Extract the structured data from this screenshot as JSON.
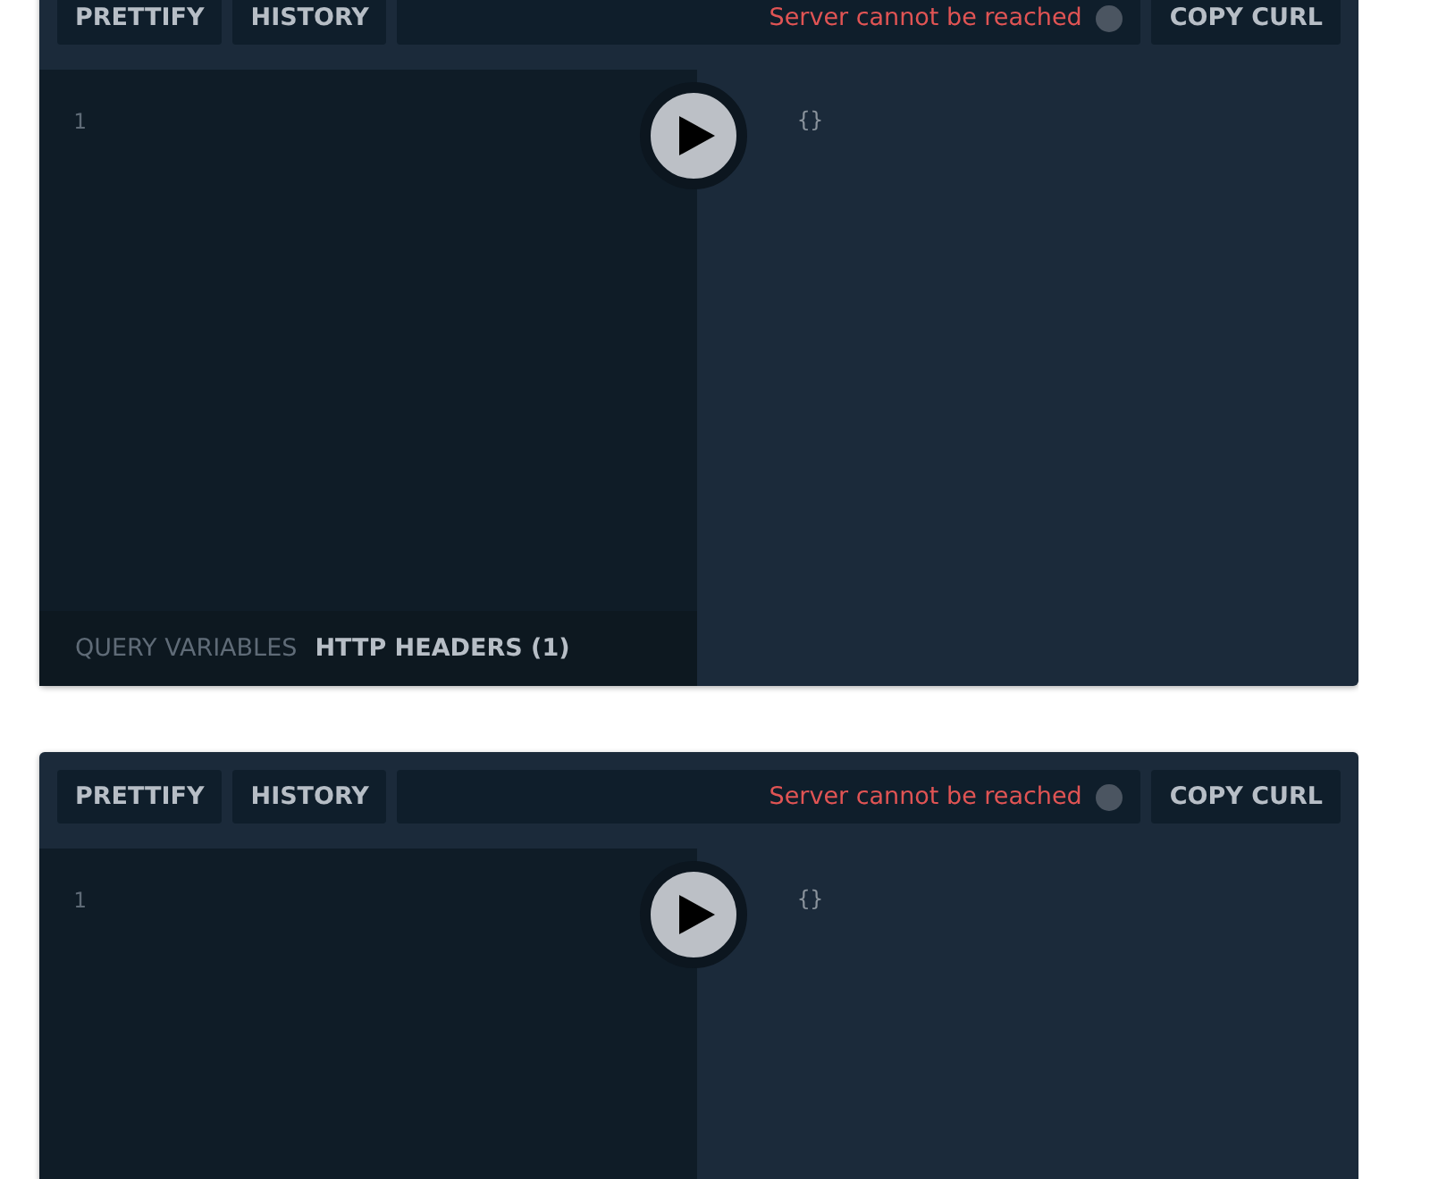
{
  "panels": [
    {
      "toolbar": {
        "buttons": [
          "PRETTIFY",
          "HISTORY"
        ],
        "status": "Server cannot be reached",
        "action": "COPY CURL"
      },
      "editor": {
        "line_numbers": [
          "1"
        ]
      },
      "result": "{}",
      "footer_tabs": [
        {
          "label": "QUERY VARIABLES",
          "selected": false
        },
        {
          "label": "HTTP HEADERS (1)",
          "selected": true
        }
      ]
    },
    {
      "toolbar": {
        "buttons": [
          "PRETTIFY",
          "HISTORY"
        ],
        "status": "Server cannot be reached",
        "action": "COPY CURL"
      },
      "editor": {
        "line_numbers": [
          "1"
        ]
      },
      "result": "{}"
    }
  ]
}
